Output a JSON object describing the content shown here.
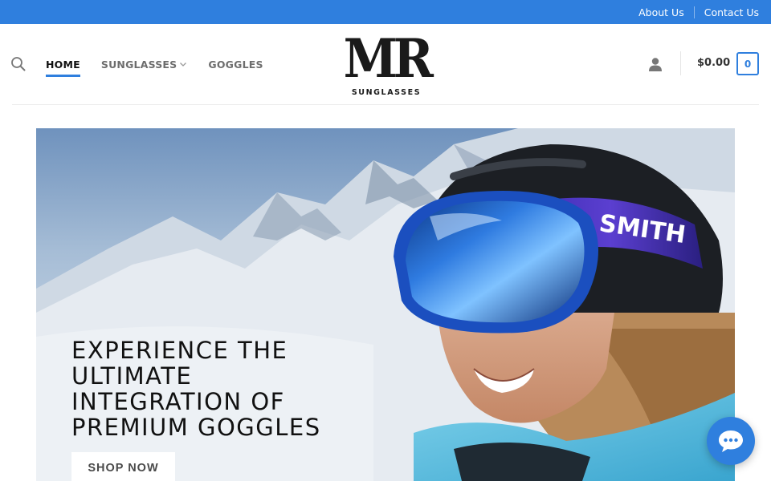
{
  "topbar": {
    "links": [
      {
        "label": "About Us"
      },
      {
        "label": "Contact Us"
      }
    ]
  },
  "nav": {
    "items": [
      {
        "label": "HOME",
        "active": true
      },
      {
        "label": "SUNGLASSES",
        "has_dropdown": true
      },
      {
        "label": "GOGGLES"
      }
    ]
  },
  "logo": {
    "mark": "MR",
    "subtitle": "SUNGLASSES"
  },
  "cart": {
    "total": "$0.00",
    "count": "0"
  },
  "hero": {
    "title_lines": [
      "EXPERIENCE THE",
      "ULTIMATE",
      "INTEGRATION OF",
      "PREMIUM GOGGLES"
    ],
    "button_label": "SHOP NOW",
    "strap_text": "SMITH"
  },
  "colors": {
    "accent": "#2f7fde",
    "text": "#111111",
    "nav_muted": "#6d6d6d"
  },
  "icons": [
    "search-icon",
    "chevron-down-icon",
    "user-icon",
    "chat-icon"
  ]
}
